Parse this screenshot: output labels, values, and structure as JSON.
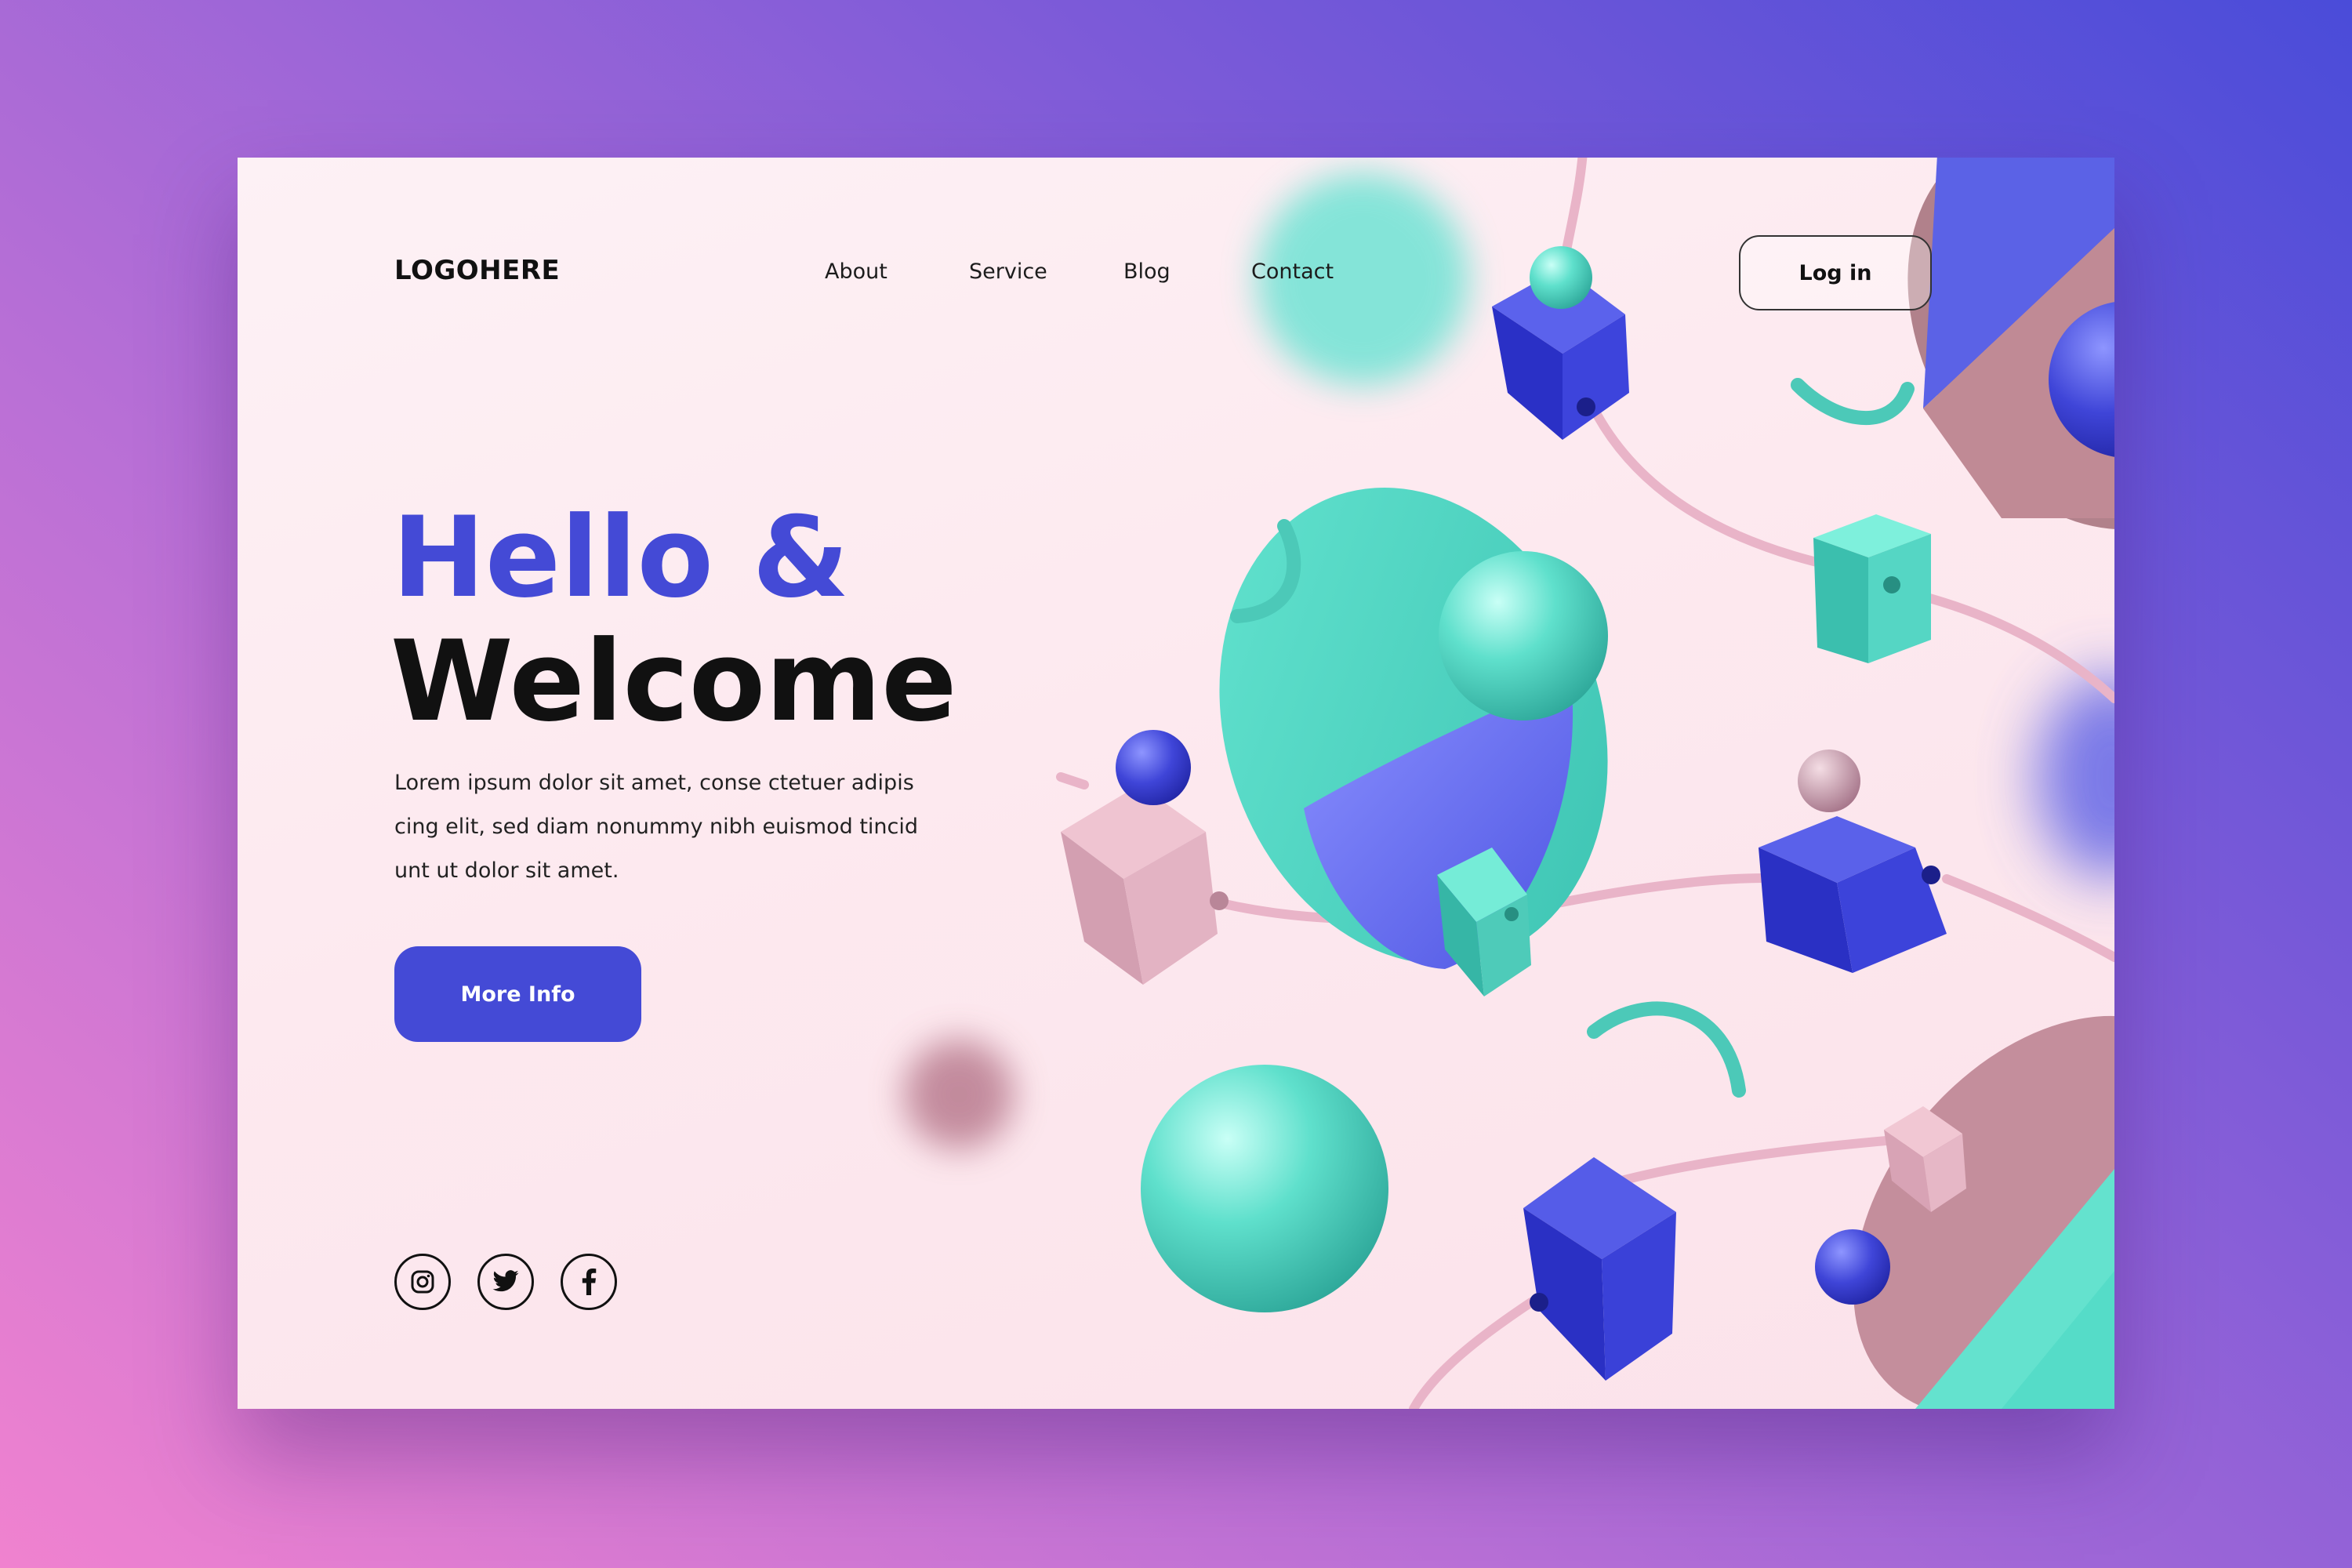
{
  "brand": {
    "logo_text": "LOGOHERE"
  },
  "nav": {
    "items": [
      {
        "label": "About"
      },
      {
        "label": "Service"
      },
      {
        "label": "Blog"
      },
      {
        "label": "Contact"
      }
    ],
    "login_label": "Log in"
  },
  "hero": {
    "title_line1": "Hello &",
    "title_line2": "Welcome",
    "description": "Lorem ipsum dolor sit amet, conse ctetuer adipis cing elit, sed diam nonummy nibh euismod tincid unt ut dolor sit amet.",
    "cta_label": "More Info"
  },
  "social": {
    "icons": [
      "instagram-icon",
      "twitter-icon",
      "facebook-icon"
    ]
  },
  "colors": {
    "accent": "#444ad6",
    "teal": "#4fd6c4",
    "pink": "#e8b7c6",
    "text": "#111111"
  }
}
